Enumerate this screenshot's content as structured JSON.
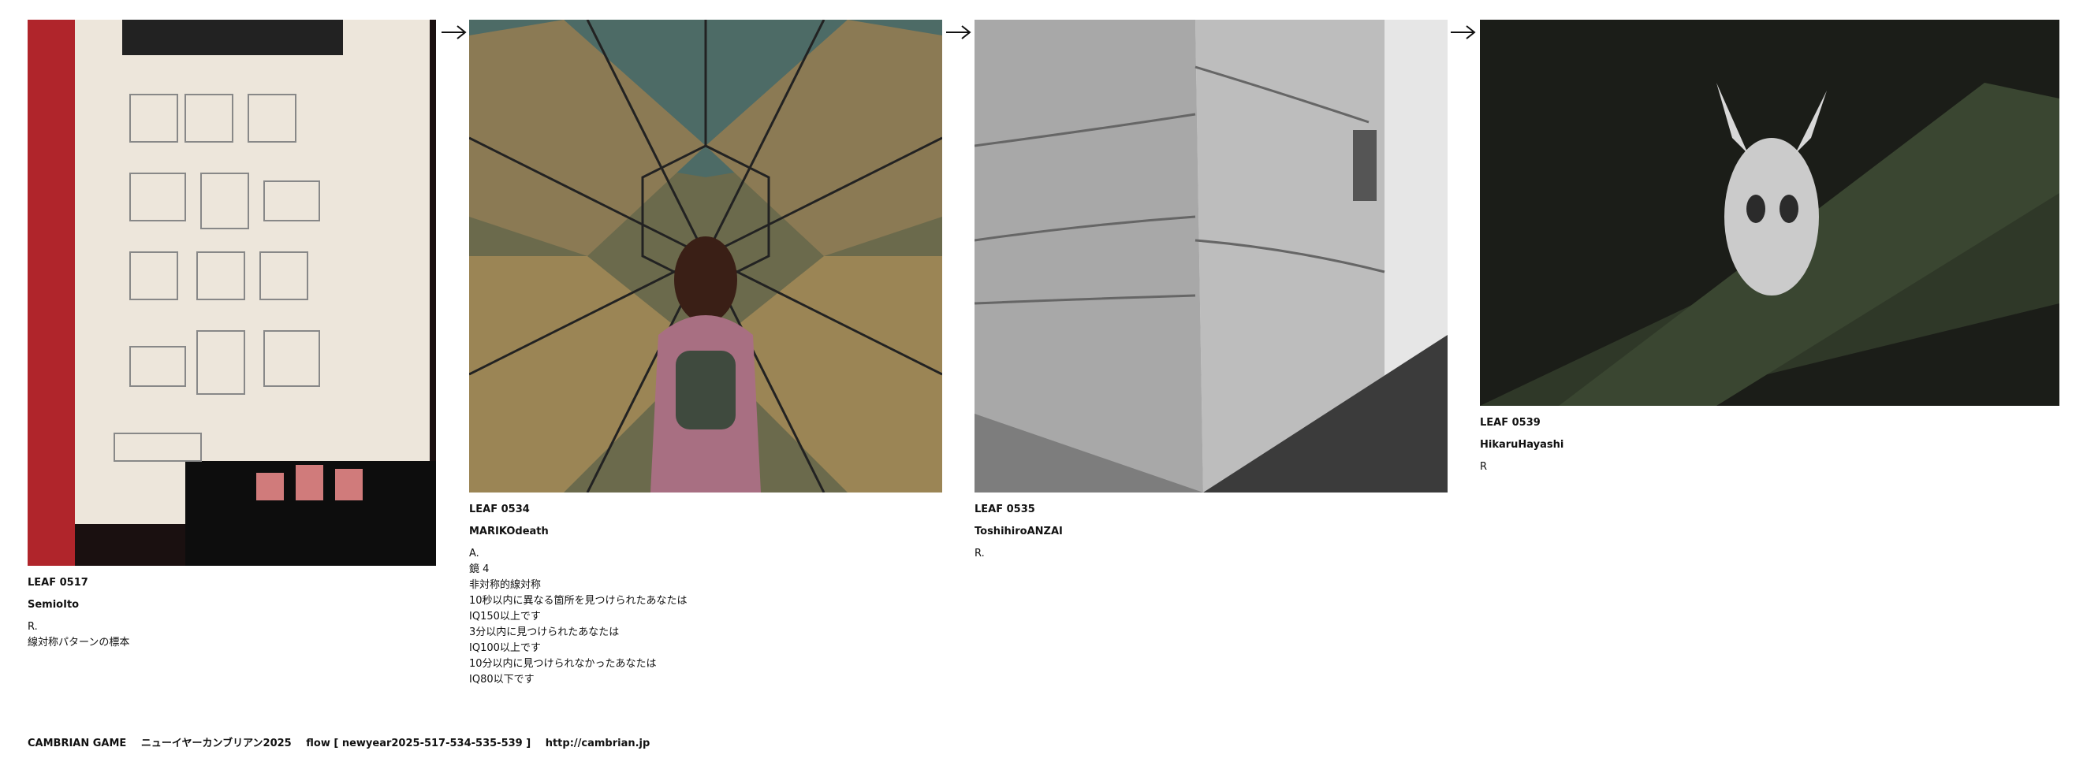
{
  "leaves": [
    {
      "id": "LEAF 0517",
      "author": "SemioIto",
      "caption": [
        "R.",
        "線対称パターンの標本"
      ],
      "image": "photo of paper clipboard with grid figures"
    },
    {
      "id": "LEAF 0534",
      "author": "MARIKOdeath",
      "caption": [
        "A.",
        "鏡 4",
        "非対称的線対称",
        "10秒以内に異なる箇所を見つけられたあなたは",
        "IQ150以上です",
        "3分以内に見つけられたあなたは",
        "IQ100以上です",
        "10分以内に見つけられなかったあなたは",
        "IQ80以下です"
      ],
      "image": "kaleidoscope of mountain terraces with woman"
    },
    {
      "id": "LEAF 0535",
      "author": "ToshihiroANZAI",
      "caption": [
        "R."
      ],
      "image": "photo of concrete building corner"
    },
    {
      "id": "LEAF 0539",
      "author": "HikaruHayashi",
      "caption": [
        "R"
      ],
      "image": "photo of animal skull on mossy slope"
    }
  ],
  "arrows": [
    "arrow-icon",
    "arrow-icon",
    "arrow-icon"
  ],
  "footer": {
    "title": "CAMBRIAN GAME",
    "subtitle": "ニューイヤーカンブリアン2025",
    "flow": "flow [ newyear2025-517-534-535-539 ]",
    "url": "http://cambrian.jp"
  }
}
